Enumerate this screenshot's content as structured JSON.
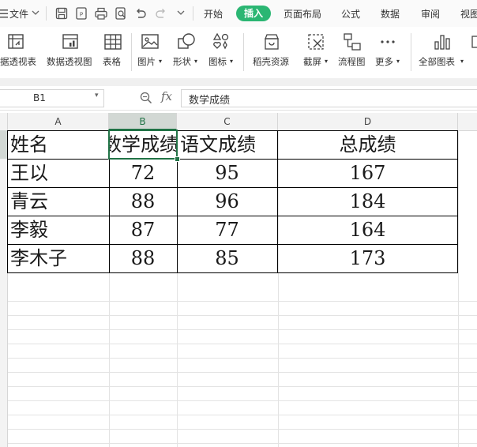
{
  "menubar": {
    "file_label": "文件",
    "tabs": [
      "开始",
      "插入",
      "页面布局",
      "公式",
      "数据",
      "审阅",
      "视图"
    ],
    "active_tab": "插入"
  },
  "ribbon": {
    "items": [
      {
        "label": "据透视表",
        "icon": "pivot-table-icon"
      },
      {
        "label": "数据透视图",
        "icon": "pivot-chart-icon"
      },
      {
        "label": "表格",
        "icon": "table-icon"
      },
      {
        "label": "图片",
        "icon": "picture-icon",
        "dropdown": true
      },
      {
        "label": "形状",
        "icon": "shape-icon",
        "dropdown": true
      },
      {
        "label": "图标",
        "icon": "icon-library-icon",
        "dropdown": true
      },
      {
        "label": "稻壳资源",
        "icon": "docer-resource-icon"
      },
      {
        "label": "截屏",
        "icon": "screenshot-icon",
        "dropdown": true
      },
      {
        "label": "流程图",
        "icon": "flowchart-icon"
      },
      {
        "label": "更多",
        "icon": "more-icon",
        "dropdown": true
      },
      {
        "label": "全部图表",
        "icon": "all-charts-icon",
        "dropdown": true
      }
    ]
  },
  "formula_bar": {
    "name_box": "B1",
    "fx_label": "fx",
    "content": "数学成绩"
  },
  "sheet": {
    "columns": [
      "A",
      "B",
      "C",
      "D"
    ],
    "selected_column": "B",
    "rows": [
      [
        "姓名",
        "数学成绩",
        "语文成绩",
        "总成绩"
      ],
      [
        "王以",
        "72",
        "95",
        "167"
      ],
      [
        "青云",
        "88",
        "96",
        "184"
      ],
      [
        "李毅",
        "87",
        "77",
        "164"
      ],
      [
        "李木子",
        "88",
        "85",
        "173"
      ]
    ]
  },
  "colors": {
    "accent": "#2bb673",
    "selection": "#217346"
  }
}
